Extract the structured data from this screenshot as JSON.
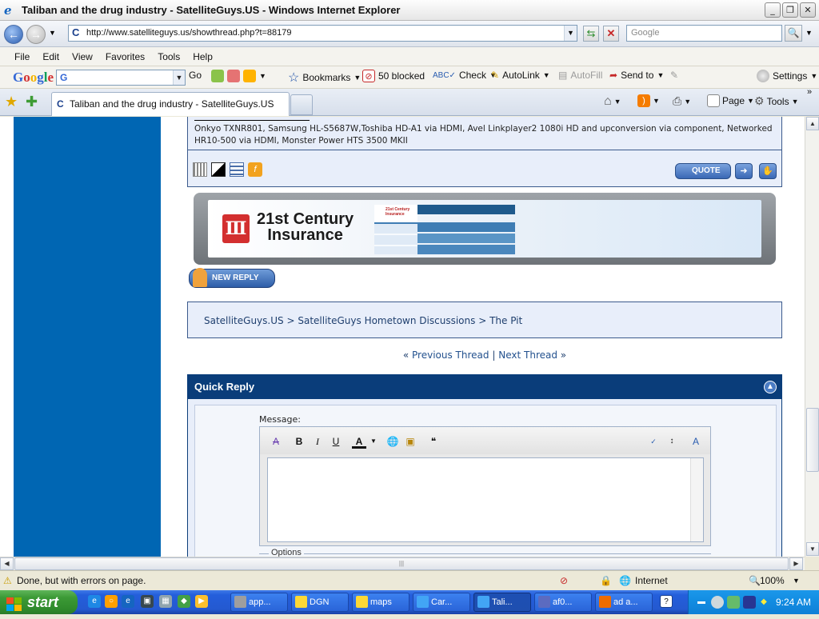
{
  "window": {
    "title": "Taliban and the drug industry - SatelliteGuys.US - Windows Internet Explorer",
    "minimize": "_",
    "maximize": "❐",
    "close": "✕"
  },
  "address": {
    "url": "http://www.satelliteguys.us/showthread.php?t=88179",
    "search_placeholder": "Google"
  },
  "menu": [
    "File",
    "Edit",
    "View",
    "Favorites",
    "Tools",
    "Help"
  ],
  "google_toolbar": {
    "logo": "Google",
    "search_value": "G",
    "go": "Go",
    "bookmarks": "Bookmarks",
    "blocked": "50 blocked",
    "check": "Check",
    "autolink": "AutoLink",
    "autofill": "AutoFill",
    "sendto": "Send to",
    "settings": "Settings"
  },
  "tabs": {
    "active": "Taliban and the drug industry - SatelliteGuys.US",
    "page": "Page",
    "tools": "Tools"
  },
  "post": {
    "signature": "Onkyo TXNR801, Samsung HL-S5687W,Toshiba HD-A1 via HDMI, Avel Linkplayer2 1080i HD and upconversion via component, Networked HR10-500 via HDMI, Monster Power HTS 3500 MKII",
    "quote_label": "QUOTE"
  },
  "ad": {
    "brand_line1": "21st Century",
    "brand_line2": "Insurance",
    "small_brand": "21st Century Insurance"
  },
  "new_reply": "NEW REPLY",
  "breadcrumb": {
    "items": [
      "SatelliteGuys.US",
      "SatelliteGuys Hometown Discussions",
      "The Pit"
    ],
    "sep": ">"
  },
  "thread_nav": {
    "prev": "Previous Thread",
    "next": "Next Thread",
    "divider": "|",
    "left_quote": "«",
    "right_quote": "»"
  },
  "quick_reply": {
    "title": "Quick Reply",
    "message_label": "Message:",
    "options_label": "Options"
  },
  "statusbar": {
    "text": "Done, but with errors on page.",
    "zone": "Internet",
    "zoom": "100%"
  },
  "taskbar": {
    "start": "start",
    "tasks": [
      "app...",
      "DGN",
      "maps",
      "Car...",
      "Tali...",
      "af0...",
      "ad a..."
    ],
    "clock": "9:24 AM"
  },
  "colors": {
    "blue_column": "#0066b3",
    "quick_reply_header": "#0a3d7a",
    "post_bg": "#e8eefa"
  }
}
